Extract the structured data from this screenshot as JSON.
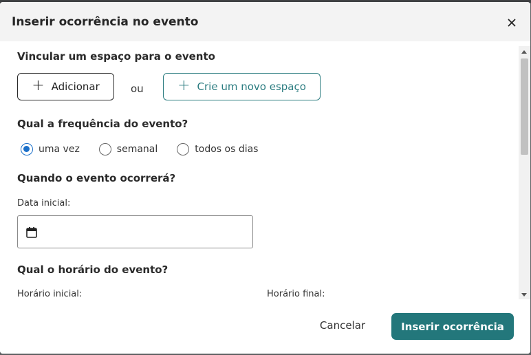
{
  "dialog": {
    "title": "Inserir ocorrência no evento",
    "close_icon": "close-icon"
  },
  "space_section": {
    "title": "Vincular um espaço para o evento",
    "add_label": "Adicionar",
    "or_label": "ou",
    "new_label": "Crie um novo espaço",
    "plus_icon": "plus-icon",
    "accent_color": "#2b7c80"
  },
  "frequency_section": {
    "title": "Qual a frequência do evento?",
    "options": [
      {
        "label": "uma vez",
        "selected": true
      },
      {
        "label": "semanal",
        "selected": false
      },
      {
        "label": "todos os dias",
        "selected": false
      }
    ],
    "selected_color": "#1a6fc9"
  },
  "when_section": {
    "title": "Quando o evento ocorrerá?",
    "start_date_label": "Data inicial:",
    "start_date_value": "",
    "calendar_icon": "calendar-icon"
  },
  "time_section": {
    "title": "Qual o horário do evento?",
    "start_time_label": "Horário inicial:",
    "end_time_label": "Horário final:"
  },
  "footer": {
    "cancel_label": "Cancelar",
    "submit_label": "Inserir ocorrência",
    "submit_color": "#23777b"
  }
}
